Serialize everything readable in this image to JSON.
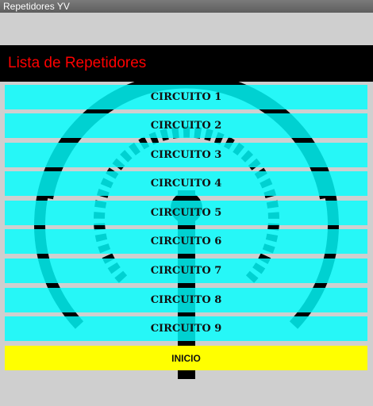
{
  "window": {
    "title": "Repetidores YV"
  },
  "header": {
    "title": "Lista de Repetidores",
    "title_color": "#ff0000",
    "background": "#000000"
  },
  "circuits": [
    {
      "label": "CIRCUITO 1"
    },
    {
      "label": "CIRCUITO 2"
    },
    {
      "label": "CIRCUITO 3"
    },
    {
      "label": "CIRCUITO 4"
    },
    {
      "label": "CIRCUITO 5"
    },
    {
      "label": "CIRCUITO 6"
    },
    {
      "label": "CIRCUITO 7"
    },
    {
      "label": "CIRCUITO 8"
    },
    {
      "label": "CIRCUITO 9"
    }
  ],
  "footer": {
    "inicio_label": "INICIO"
  },
  "colors": {
    "button": "#00ffff",
    "inicio": "#ffff00",
    "page_bg": "#cfcfcf"
  },
  "background_icon": "radio-tower-signal-icon"
}
